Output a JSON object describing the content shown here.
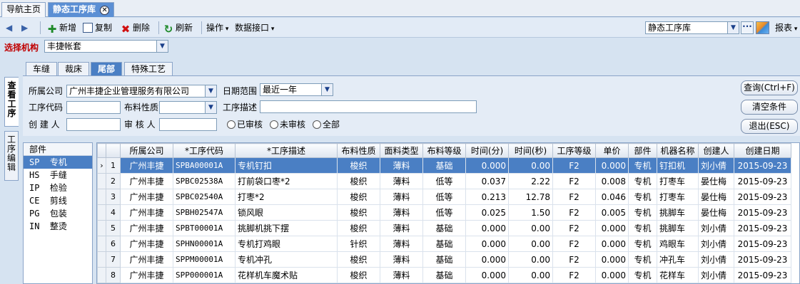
{
  "tabs": [
    {
      "label": "导航主页"
    },
    {
      "label": "静态工序库"
    }
  ],
  "toolbar": {
    "new": "新增",
    "copy": "复制",
    "delete": "删除",
    "refresh": "刷新",
    "operations": "操作",
    "data_interface": "数据接口",
    "module_select": "静态工序库",
    "report": "报表"
  },
  "org": {
    "label": "选择机构",
    "value": "丰捷帐套"
  },
  "subtabs": [
    "车缝",
    "裁床",
    "尾部",
    "特殊工艺"
  ],
  "side_tabs": [
    "查看工序",
    "工序编辑"
  ],
  "filter": {
    "company_label": "所属公司",
    "company_value": "广州丰捷企业管理服务有限公司",
    "date_label": "日期范围",
    "date_value": "最近一年",
    "code_label": "工序代码",
    "material_label": "布料性质",
    "desc_label": "工序描述",
    "creator_label": "创 建 人",
    "reviewer_label": "审 核 人",
    "radio_reviewed": "已审核",
    "radio_unreviewed": "未审核",
    "radio_all": "全部",
    "query_button": "查询(Ctrl+F)",
    "clear_button": "清空条件",
    "exit_button": "退出(ESC)"
  },
  "categories": {
    "header": "部件",
    "items": [
      "SP  专机",
      "HS  手缝",
      "IP  检验",
      "CE  剪线",
      "PG  包装",
      "IN  整烫"
    ]
  },
  "grid": {
    "columns": [
      "所属公司",
      "*工序代码",
      "*工序描述",
      "布料性质",
      "面料类型",
      "布料等级",
      "时间(分)",
      "时间(秒)",
      "工序等级",
      "单价",
      "部件",
      "机器名称",
      "创建人",
      "创建日期"
    ],
    "rows": [
      {
        "num": "1",
        "company": "广州丰捷",
        "code": "SPBA00001A",
        "desc": "专机钉扣",
        "material": "梭织",
        "fabric": "薄料",
        "grade": "基础",
        "min": "0.000",
        "sec": "0.00",
        "level": "F2",
        "price": "0.000",
        "part": "专机",
        "machine": "钉扣机",
        "creator": "刘小倩",
        "date": "2015-09-23"
      },
      {
        "num": "2",
        "company": "广州丰捷",
        "code": "SPBC02538A",
        "desc": "打前袋口枣*2",
        "material": "梭织",
        "fabric": "薄料",
        "grade": "低等",
        "min": "0.037",
        "sec": "2.22",
        "level": "F2",
        "price": "0.008",
        "part": "专机",
        "machine": "打枣车",
        "creator": "晏仕梅",
        "date": "2015-09-23"
      },
      {
        "num": "3",
        "company": "广州丰捷",
        "code": "SPBC02540A",
        "desc": "打枣*2",
        "material": "梭织",
        "fabric": "薄料",
        "grade": "低等",
        "min": "0.213",
        "sec": "12.78",
        "level": "F2",
        "price": "0.046",
        "part": "专机",
        "machine": "打枣车",
        "creator": "晏仕梅",
        "date": "2015-09-23"
      },
      {
        "num": "4",
        "company": "广州丰捷",
        "code": "SPBH02547A",
        "desc": "锁风眼",
        "material": "梭织",
        "fabric": "薄料",
        "grade": "低等",
        "min": "0.025",
        "sec": "1.50",
        "level": "F2",
        "price": "0.005",
        "part": "专机",
        "machine": "挑脚车",
        "creator": "晏仕梅",
        "date": "2015-09-23"
      },
      {
        "num": "5",
        "company": "广州丰捷",
        "code": "SPBT00001A",
        "desc": "挑脚机挑下摆",
        "material": "梭织",
        "fabric": "薄料",
        "grade": "基础",
        "min": "0.000",
        "sec": "0.00",
        "level": "F2",
        "price": "0.000",
        "part": "专机",
        "machine": "挑脚车",
        "creator": "刘小倩",
        "date": "2015-09-23"
      },
      {
        "num": "6",
        "company": "广州丰捷",
        "code": "SPHN00001A",
        "desc": "专机打鸡眼",
        "material": "针织",
        "fabric": "薄料",
        "grade": "基础",
        "min": "0.000",
        "sec": "0.00",
        "level": "F2",
        "price": "0.000",
        "part": "专机",
        "machine": "鸡眼车",
        "creator": "刘小倩",
        "date": "2015-09-23"
      },
      {
        "num": "7",
        "company": "广州丰捷",
        "code": "SPPM00001A",
        "desc": "专机冲孔",
        "material": "梭织",
        "fabric": "薄料",
        "grade": "基础",
        "min": "0.000",
        "sec": "0.00",
        "level": "F2",
        "price": "0.000",
        "part": "专机",
        "machine": "冲孔车",
        "creator": "刘小倩",
        "date": "2015-09-23"
      },
      {
        "num": "8",
        "company": "广州丰捷",
        "code": "SPP000001A",
        "desc": "花样机车魔术贴",
        "material": "梭织",
        "fabric": "薄料",
        "grade": "基础",
        "min": "0.000",
        "sec": "0.00",
        "level": "F2",
        "price": "0.000",
        "part": "专机",
        "machine": "花样车",
        "creator": "刘小倩",
        "date": "2015-09-23"
      }
    ]
  },
  "colors": {
    "accent": "#4a7fc4",
    "label_red": "#c00000",
    "background": "#d6e3f1"
  }
}
